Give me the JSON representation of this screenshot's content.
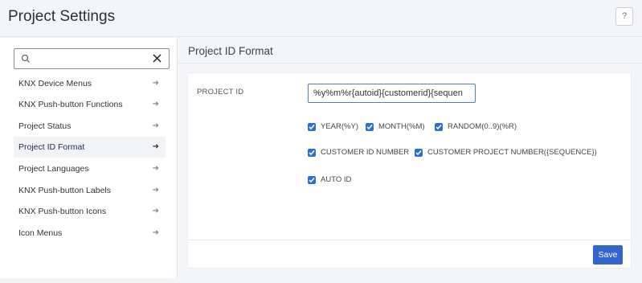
{
  "header": {
    "title": "Project Settings",
    "help_label": "?"
  },
  "sidebar": {
    "search": {
      "value": "",
      "placeholder": ""
    },
    "items": [
      {
        "label": "KNX Device Menus"
      },
      {
        "label": "KNX Push-button Functions"
      },
      {
        "label": "Project Status"
      },
      {
        "label": "Project ID Format",
        "active": true
      },
      {
        "label": "Project Languages"
      },
      {
        "label": "KNX Push-button Labels"
      },
      {
        "label": "KNX Push-button Icons"
      },
      {
        "label": "Icon Menus"
      }
    ],
    "arrow_glyph": "➜"
  },
  "main": {
    "title": "Project ID Format",
    "project_id_label": "PROJECT ID",
    "project_id_value": "%y%m%r{autoid}{customerid}{sequen",
    "options": [
      {
        "label": "YEAR(%Y)",
        "checked": true
      },
      {
        "label": "MONTH(%M)",
        "checked": true
      },
      {
        "label": "RANDOM(0..9)(%R)",
        "checked": true
      },
      {
        "label": "CUSTOMER ID NUMBER",
        "checked": true
      },
      {
        "label": "CUSTOMER PROJECT NUMBER({SEQUENCE})",
        "checked": true
      },
      {
        "label": "AUTO ID",
        "checked": true
      }
    ],
    "save_label": "Save"
  },
  "colors": {
    "accent": "#3366cc",
    "checkbox": "#2d6fd1"
  }
}
